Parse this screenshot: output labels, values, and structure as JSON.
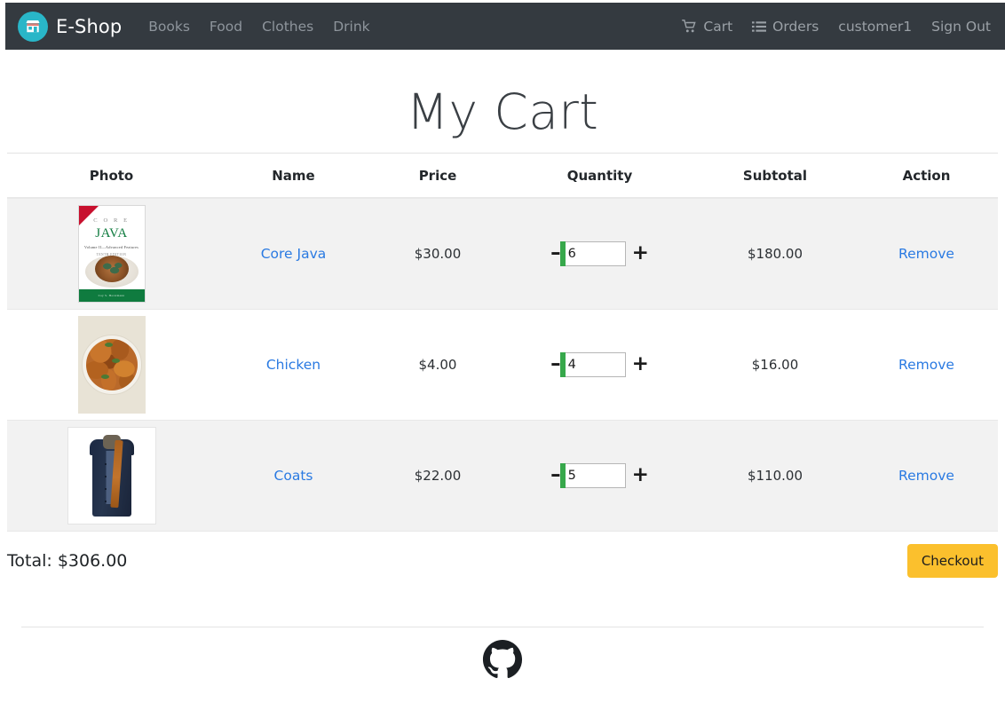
{
  "navbar": {
    "brand": "E-Shop",
    "logo_icon": "shop-storefront-icon",
    "logo_color": "#29b6c8",
    "background_color": "#343a40",
    "links": [
      {
        "label": "Books"
      },
      {
        "label": "Food"
      },
      {
        "label": "Clothes"
      },
      {
        "label": "Drink"
      }
    ],
    "right": [
      {
        "label": "Cart",
        "icon": "shopping-cart-icon"
      },
      {
        "label": "Orders",
        "icon": "list-ul-icon"
      },
      {
        "label": "customer1",
        "icon": null
      },
      {
        "label": "Sign Out",
        "icon": null
      }
    ]
  },
  "page": {
    "title": "My Cart"
  },
  "table": {
    "headers": [
      "Photo",
      "Name",
      "Price",
      "Quantity",
      "Subtotal",
      "Action"
    ],
    "rows": [
      {
        "photo_icon": "core-java-book-cover",
        "name": "Core Java",
        "price": "$30.00",
        "quantity": "6",
        "subtotal": "$180.00",
        "action": "Remove"
      },
      {
        "photo_icon": "chicken-plate-photo",
        "name": "Chicken",
        "price": "$4.00",
        "quantity": "4",
        "subtotal": "$16.00",
        "action": "Remove"
      },
      {
        "photo_icon": "navy-coat-photo",
        "name": "Coats",
        "price": "$22.00",
        "quantity": "5",
        "subtotal": "$110.00",
        "action": "Remove"
      }
    ]
  },
  "book_cover": {
    "core": "C O R E",
    "java": "JAVA",
    "volume": "Volume II—Advanced Features",
    "edition": "TENTH EDITION",
    "band": "Cay S. Horstmann"
  },
  "stepper": {
    "minus_label": "–",
    "plus_label": "+",
    "accent_color": "#37a84b"
  },
  "summary": {
    "total_label": "Total: $306.00",
    "checkout_label": "Checkout",
    "checkout_color": "#fbc02d"
  },
  "footer": {
    "github_icon": "github-octocat-icon"
  }
}
